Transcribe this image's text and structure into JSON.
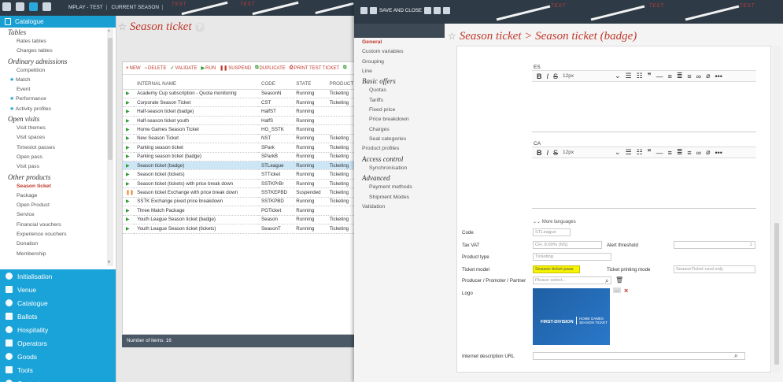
{
  "topbar": {
    "breadcrumbs": [
      "MPLAY - TEST",
      "CURRENT SEASON"
    ],
    "watermark": "TEST"
  },
  "sidebar": {
    "header": "Catalogue",
    "tree": [
      {
        "type": "grp",
        "label": "Tables"
      },
      {
        "type": "it",
        "label": "Rates tables"
      },
      {
        "type": "it",
        "label": "Charges tables"
      },
      {
        "type": "grp",
        "label": "Ordinary admissions"
      },
      {
        "type": "it",
        "label": "Competition"
      },
      {
        "type": "star",
        "label": "Match"
      },
      {
        "type": "it",
        "label": "Event"
      },
      {
        "type": "star",
        "label": "Performance"
      },
      {
        "type": "star",
        "label": "Activity profiles"
      },
      {
        "type": "grp",
        "label": "Open visits"
      },
      {
        "type": "it",
        "label": "Visit themes"
      },
      {
        "type": "it",
        "label": "Visit spaces"
      },
      {
        "type": "it",
        "label": "Timeslot passes"
      },
      {
        "type": "it",
        "label": "Open pass"
      },
      {
        "type": "it",
        "label": "Visit pass"
      },
      {
        "type": "grp",
        "label": "Other products"
      },
      {
        "type": "sel",
        "label": "Season ticket"
      },
      {
        "type": "it",
        "label": "Package"
      },
      {
        "type": "it",
        "label": "Open Product"
      },
      {
        "type": "it",
        "label": "Service"
      },
      {
        "type": "it",
        "label": "Financial vouchers"
      },
      {
        "type": "it",
        "label": "Experience vouchers"
      },
      {
        "type": "it",
        "label": "Donation"
      },
      {
        "type": "it",
        "label": "Membership"
      }
    ],
    "nav": [
      "Initialisation",
      "Venue",
      "Catalogue",
      "Ballots",
      "Hospitality",
      "Operators",
      "Goods",
      "Tools",
      "Contact"
    ]
  },
  "main": {
    "title": "Season ticket",
    "help": "?",
    "toolbar": [
      {
        "icon": "+",
        "label": "NEW"
      },
      {
        "icon": "−",
        "label": "DELETE"
      },
      {
        "icon": "✓",
        "label": "VALIDATE"
      },
      {
        "icon": "▶",
        "label": "RUN"
      },
      {
        "icon": "❚❚",
        "label": "SUSPEND"
      },
      {
        "icon": "⧉",
        "label": "DUPLICATE"
      },
      {
        "icon": "⎙",
        "label": "PRINT TEST TICKET"
      },
      {
        "icon": "⧉",
        "label": ""
      }
    ],
    "columns": [
      "INTERNAL NAME",
      "CODE",
      "STATE",
      "PRODUCT"
    ],
    "rows": [
      {
        "name": "Academy Cup subscription - Quota monitoring",
        "code": "SeasonN",
        "state": "Running",
        "product": "Ticketing",
        "status": "run"
      },
      {
        "name": "Corporate Season Ticket",
        "code": "CST",
        "state": "Running",
        "product": "Ticketing",
        "status": "run"
      },
      {
        "name": "Half-season ticket (badge)",
        "code": "HalfST",
        "state": "Running",
        "product": "",
        "status": "run"
      },
      {
        "name": "Half-season ticket youth",
        "code": "HalfS",
        "state": "Running",
        "product": "",
        "status": "run"
      },
      {
        "name": "Home Games Season Ticket",
        "code": "HG_SSTK",
        "state": "Running",
        "product": "",
        "status": "run"
      },
      {
        "name": "New Season Ticket",
        "code": "NST",
        "state": "Running",
        "product": "Ticketing",
        "status": "run"
      },
      {
        "name": "Parking season ticket",
        "code": "SPark",
        "state": "Running",
        "product": "Ticketing",
        "status": "run"
      },
      {
        "name": "Parking season ticket (badge)",
        "code": "SParkB",
        "state": "Running",
        "product": "Ticketing",
        "status": "run"
      },
      {
        "name": "Season ticket (badge)",
        "code": "STLeague",
        "state": "Running",
        "product": "Ticketing",
        "status": "run",
        "selected": true
      },
      {
        "name": "Season ticket (tickets)",
        "code": "STTicket",
        "state": "Running",
        "product": "Ticketing",
        "status": "run"
      },
      {
        "name": "Season ticket (tickets) with price break down",
        "code": "SSTKPrBr",
        "state": "Running",
        "product": "Ticketing",
        "status": "run"
      },
      {
        "name": "Season ticket Exchange with price break down",
        "code": "SSTKEPBD",
        "state": "Suspended",
        "product": "Ticketing",
        "status": "pause"
      },
      {
        "name": "SSTK Exchange pixed price breakdown",
        "code": "SSTKPBD",
        "state": "Running",
        "product": "Ticketing",
        "status": "run"
      },
      {
        "name": "Three Match Package",
        "code": "PGTicket",
        "state": "Running",
        "product": "",
        "status": "run"
      },
      {
        "name": "Youth League Season ticket (badge)",
        "code": "Season",
        "state": "Running",
        "product": "Ticketing",
        "status": "run"
      },
      {
        "name": "Youth League Season ticket (tickets)",
        "code": "SeasonT",
        "state": "Running",
        "product": "Ticketing",
        "status": "run"
      }
    ],
    "footer": "Number of items: 16"
  },
  "modal": {
    "topbar_label": "SAVE AND CLOSE",
    "title": "Season ticket > Season ticket (badge)",
    "menu": [
      {
        "type": "act",
        "label": "General"
      },
      {
        "type": "l",
        "label": "Custom variables"
      },
      {
        "type": "l",
        "label": "Grouping"
      },
      {
        "type": "l",
        "label": "Line"
      },
      {
        "type": "grp",
        "label": "Basic offers"
      },
      {
        "type": "sub",
        "label": "Quotas"
      },
      {
        "type": "sub",
        "label": "Tariffs"
      },
      {
        "type": "sub",
        "label": "Fixed price"
      },
      {
        "type": "sub",
        "label": "Price breakdown"
      },
      {
        "type": "sub",
        "label": "Charges"
      },
      {
        "type": "sub",
        "label": "Seat categories"
      },
      {
        "type": "l",
        "label": "Product profiles"
      },
      {
        "type": "grp",
        "label": "Access control"
      },
      {
        "type": "sub",
        "label": "Synchronisation"
      },
      {
        "type": "grp",
        "label": "Advanced"
      },
      {
        "type": "sub",
        "label": "Payment methods"
      },
      {
        "type": "sub",
        "label": "Shipment Modes"
      },
      {
        "type": "l",
        "label": "Validation"
      }
    ],
    "editors": [
      {
        "lang": "ES",
        "font_size": "12px"
      },
      {
        "lang": "CA",
        "font_size": "12px"
      }
    ],
    "more_languages": "More languages",
    "fields": {
      "code_label": "Code",
      "code_value": "STLeague",
      "tax_label": "Tax VAT",
      "tax_value": "CH, 8.00% (NS)",
      "alert_label": "Alert threshold",
      "alert_value": "1",
      "ptype_label": "Product type",
      "ptype_value": "Ticketing",
      "tmodel_label": "Ticket model",
      "tmodel_value": "Season ticket pass",
      "tpm_label": "Ticket printing mode",
      "tpm_value": "SeasonTicket card only",
      "producer_label": "Producer / Promoter / Partner",
      "producer_placeholder": "Please select...",
      "logo_label": "Logo",
      "logo_brand": "FIRST-DIVISION",
      "logo_line1": "HOME GAMES",
      "logo_line2": "SEASON TICKET",
      "url_label": "Internet description URL"
    },
    "colors": {
      "accent": "#1a9fd3",
      "title_red": "#c0392b",
      "dark_bar": "#2e3b47",
      "highlight": "#f6f300"
    }
  }
}
